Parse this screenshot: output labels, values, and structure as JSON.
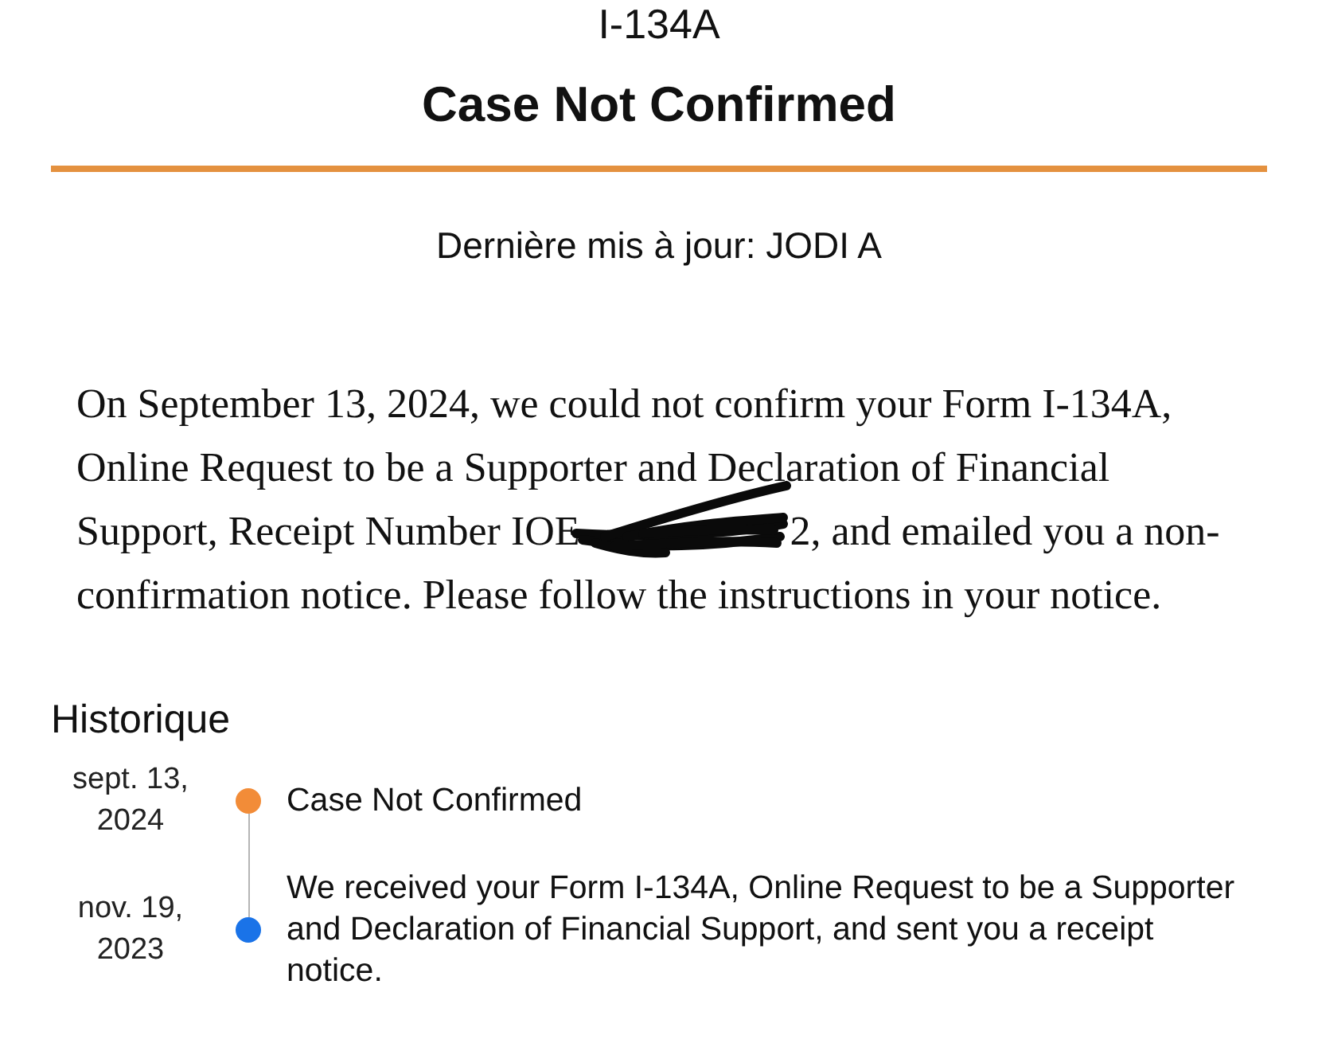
{
  "header": {
    "form_code": "I-134A",
    "status_title": "Case Not Confirmed",
    "last_updated": "Dernière mis à jour: JODI A"
  },
  "notice": {
    "text": "On September 13, 2024, we could not confirm your Form I-134A, Online Request to be a Supporter and Declaration of Financial Support, Receipt Number IOE",
    "redacted": true,
    "text_continued": "2, and emailed you a non-confirmation notice. Please follow the instructions in your notice."
  },
  "history": {
    "heading": "Historique",
    "events": [
      {
        "date": "sept. 13, 2024",
        "description": "Case Not Confirmed",
        "color": "#f28c38"
      },
      {
        "date": "nov. 19, 2023",
        "description": "We received your Form I-134A, Online Request to be a Supporter and Declaration of Financial Support, and sent you a receipt notice.",
        "color": "#1a73e8"
      }
    ]
  }
}
